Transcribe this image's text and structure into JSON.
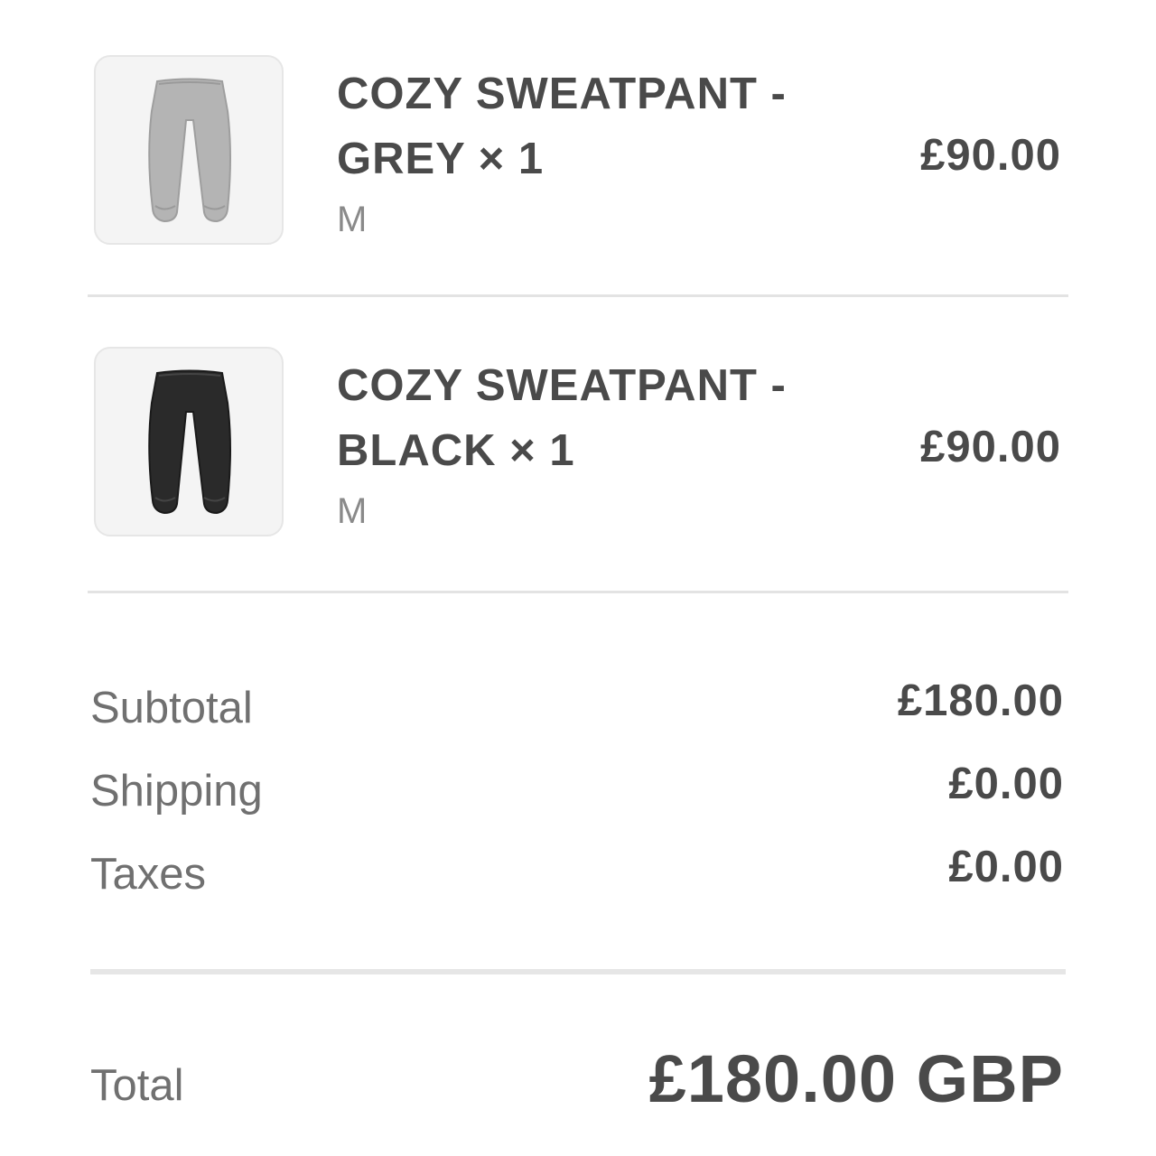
{
  "items": [
    {
      "title_line1": "COZY SWEATPANT -",
      "title_line2": "GREY × 1",
      "variant": "M",
      "price": "£90.00",
      "image_icon": "grey-sweatpant-thumbnail",
      "product_color": "#b4b4b4"
    },
    {
      "title_line1": "COZY SWEATPANT -",
      "title_line2": "BLACK × 1",
      "variant": "M",
      "price": "£90.00",
      "image_icon": "black-sweatpant-thumbnail",
      "product_color": "#2a2a2a"
    }
  ],
  "summary": {
    "subtotal_label": "Subtotal",
    "subtotal_value": "£180.00",
    "shipping_label": "Shipping",
    "shipping_value": "£0.00",
    "taxes_label": "Taxes",
    "taxes_value": "£0.00"
  },
  "total": {
    "label": "Total",
    "value": "£180.00 GBP"
  }
}
